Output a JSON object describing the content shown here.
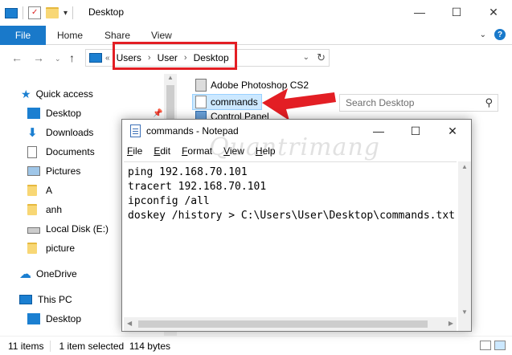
{
  "explorer": {
    "title": "Desktop",
    "ribbon_tabs": [
      "File",
      "Home",
      "Share",
      "View"
    ],
    "address": {
      "crumbs": [
        "Users",
        "User",
        "Desktop"
      ],
      "prefix": "«"
    },
    "search_placeholder": "Search Desktop",
    "accent": "#1979ca"
  },
  "nav": {
    "items": [
      {
        "label": "Quick access",
        "icon": "star-icon"
      },
      {
        "label": "Desktop",
        "icon": "desktop-icon"
      },
      {
        "label": "Downloads",
        "icon": "download-icon"
      },
      {
        "label": "Documents",
        "icon": "documents-icon"
      },
      {
        "label": "Pictures",
        "icon": "pictures-icon"
      },
      {
        "label": "A",
        "icon": "folder-icon"
      },
      {
        "label": "anh",
        "icon": "folder-icon"
      },
      {
        "label": "Local Disk (E:)",
        "icon": "drive-icon"
      },
      {
        "label": "picture",
        "icon": "folder-icon"
      },
      {
        "label": "OneDrive",
        "icon": "cloud-icon"
      },
      {
        "label": "This PC",
        "icon": "pc-icon"
      },
      {
        "label": "Desktop",
        "icon": "desktop-icon"
      }
    ]
  },
  "files": [
    {
      "name": "Adobe Photoshop CS2",
      "icon": "photoshop-shortcut-icon"
    },
    {
      "name": "commands",
      "icon": "text-file-icon",
      "selected": true
    },
    {
      "name": "Control Panel",
      "icon": "control-panel-icon"
    }
  ],
  "status": {
    "count": "11 items",
    "selection": "1 item selected  114 bytes"
  },
  "notepad": {
    "title": "commands - Notepad",
    "menu": [
      "File",
      "Edit",
      "Format",
      "View",
      "Help"
    ],
    "lines": [
      "ping 192.168.70.101",
      "tracert 192.168.70.101",
      "ipconfig /all",
      "doskey /history > C:\\Users\\User\\Desktop\\commands.txt"
    ]
  },
  "watermark": "Quantrimang"
}
